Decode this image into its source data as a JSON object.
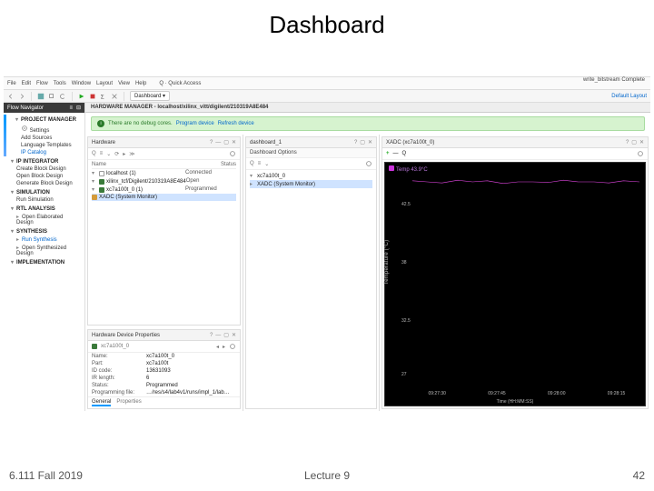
{
  "slide_title": "Dashboard",
  "menubar": {
    "items": [
      "File",
      "Edit",
      "Flow",
      "Tools",
      "Window",
      "Layout",
      "View",
      "Help"
    ],
    "quick": "Q · Quick Access",
    "right_status": "write_bitstream Complete"
  },
  "toolbar": {
    "dashboard_btn": "Dashboard ▾",
    "default_layout": "Default Layout"
  },
  "nav": {
    "title": "Flow Navigator",
    "sections": [
      {
        "label": "PROJECT MANAGER",
        "items": [
          "Settings",
          "Add Sources",
          "Language Templates",
          "IP Catalog"
        ]
      },
      {
        "label": "IP INTEGRATOR",
        "items": [
          "Create Block Design",
          "Open Block Design",
          "Generate Block Design"
        ]
      },
      {
        "label": "SIMULATION",
        "items": [
          "Run Simulation"
        ]
      },
      {
        "label": "RTL ANALYSIS",
        "items": [
          "Open Elaborated Design"
        ]
      },
      {
        "label": "SYNTHESIS",
        "items": [
          "Run Synthesis",
          "Open Synthesized Design"
        ]
      },
      {
        "label": "IMPLEMENTATION",
        "items": []
      }
    ]
  },
  "hw_title": "HARDWARE MANAGER - localhost/xilinx_vitt/digilent/210319A8E484",
  "green": {
    "msg": "There are no debug cores.",
    "link1": "Program device",
    "link2": "Refresh device"
  },
  "hw_panel": {
    "title": "Hardware",
    "columns": [
      "Name",
      "Status"
    ],
    "rows": [
      {
        "name": "localhost (1)",
        "status": "Connected",
        "icon": "host"
      },
      {
        "name": "xilinx_tcf/Digilent/210319A8E484",
        "status": "Open",
        "icon": "chip",
        "indent": 1
      },
      {
        "name": "xc7a100t_0 (1)",
        "status": "Programmed",
        "icon": "chip",
        "indent": 2
      },
      {
        "name": "XADC (System Monitor)",
        "status": "",
        "icon": "xadc",
        "indent": 3,
        "selected": true
      }
    ]
  },
  "props": {
    "title": "Hardware Device Properties",
    "device": "xc7a100t_0",
    "rows": [
      {
        "k": "Name:",
        "v": "xc7a100t_0"
      },
      {
        "k": "Part:",
        "v": "xc7a100t"
      },
      {
        "k": "ID code:",
        "v": "13631093"
      },
      {
        "k": "IR length:",
        "v": "6"
      },
      {
        "k": "Status:",
        "v": "Programmed"
      },
      {
        "k": "Programming file:",
        "v": "…/res/s4/lab4v1/runs/impl_1/lab…"
      }
    ],
    "tabs": [
      "General",
      "Properties"
    ]
  },
  "dash": {
    "title": "dashboard_1",
    "tree": [
      "xc7a100t_0",
      "XADC (System Monitor)"
    ]
  },
  "xadc": {
    "title": "XADC (xc7a100t_0)",
    "legend": "Temp 43.9°C",
    "gear": "gear-icon"
  },
  "chart_data": {
    "type": "line",
    "series": [
      {
        "name": "Temp",
        "color": "#c3d",
        "values": [
          44.2,
          44.0,
          43.8,
          44.3,
          43.9,
          44.1,
          43.7,
          44.0,
          43.9,
          43.8,
          44.2,
          43.9,
          44.0,
          43.8,
          44.1,
          43.9
        ]
      }
    ],
    "ylabel": "Temperature (°C)",
    "ylim": [
      27.0,
      45.0
    ],
    "yticks": [
      27.0,
      32.5,
      38.0,
      42.5
    ],
    "xticks": [
      "09:27:30",
      "09:27:45",
      "09:28:00",
      "09:28:15"
    ],
    "xlabel": "Time (HH:MM:SS)"
  },
  "footer": {
    "left": "6.111 Fall 2019",
    "center": "Lecture 9",
    "right": "42"
  }
}
